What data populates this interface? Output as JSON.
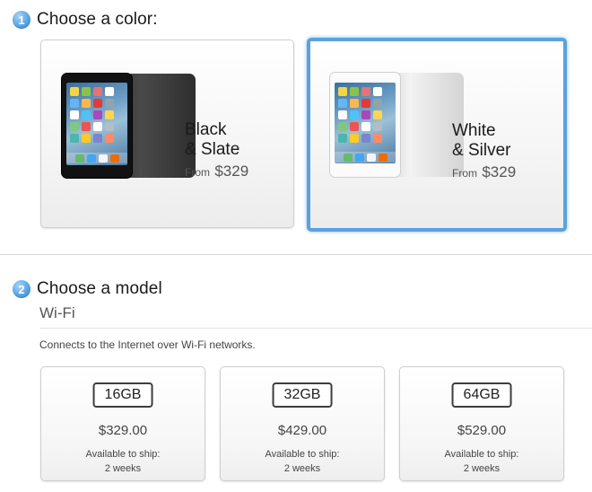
{
  "step1": {
    "number": "1",
    "title": "Choose a color:"
  },
  "colors": [
    {
      "name_line1": "Black",
      "name_line2": "& Slate",
      "from": "From",
      "price": "$329"
    },
    {
      "name_line1": "White",
      "name_line2": "& Silver",
      "from": "From",
      "price": "$329"
    }
  ],
  "selected_color": "White & Silver",
  "step2": {
    "number": "2",
    "title": "Choose a model"
  },
  "model_group": {
    "title": "Wi-Fi",
    "description": "Connects to the Internet over Wi-Fi networks."
  },
  "models": [
    {
      "capacity": "16GB",
      "price": "$329.00",
      "ship_line1": "Available to ship:",
      "ship_line2": "2 weeks"
    },
    {
      "capacity": "32GB",
      "price": "$429.00",
      "ship_line1": "Available to ship:",
      "ship_line2": "2 weeks"
    },
    {
      "capacity": "64GB",
      "price": "$529.00",
      "ship_line1": "Available to ship:",
      "ship_line2": "2 weeks"
    }
  ],
  "icons": {
    "apple_logo": "apple-logo-icon",
    "step_badge": "step-number-badge"
  },
  "colors_theme": {
    "accent": "#5aa2de",
    "step_badge": "#4a97d9"
  }
}
